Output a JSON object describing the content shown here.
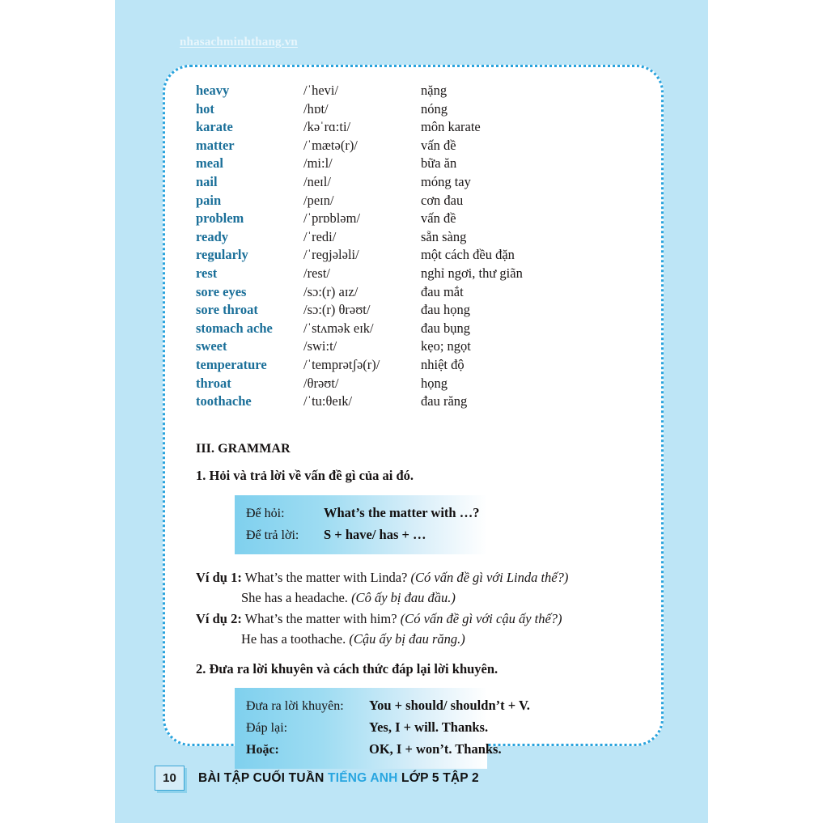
{
  "page": {
    "watermark": "nhasachminhthang.vn",
    "background_color": "#bde5f6",
    "panel_border_color": "#29a3dd",
    "accent_color": "#29a6e0",
    "headword_color": "#1a6f99"
  },
  "vocabulary": {
    "rows": [
      {
        "word": "heavy",
        "ipa": "/ˈhevi/",
        "meaning": "nặng"
      },
      {
        "word": "hot",
        "ipa": "/hɒt/",
        "meaning": "nóng"
      },
      {
        "word": "karate",
        "ipa": "/kəˈrɑ:ti/",
        "meaning": "môn karate"
      },
      {
        "word": "matter",
        "ipa": "/ˈmætə(r)/",
        "meaning": "vấn đề"
      },
      {
        "word": "meal",
        "ipa": "/mi:l/",
        "meaning": "bữa ăn"
      },
      {
        "word": "nail",
        "ipa": "/neɪl/",
        "meaning": "móng tay"
      },
      {
        "word": "pain",
        "ipa": "/peɪn/",
        "meaning": "cơn đau"
      },
      {
        "word": "problem",
        "ipa": "/ˈprɒbləm/",
        "meaning": "vấn đề"
      },
      {
        "word": "ready",
        "ipa": "/ˈredi/",
        "meaning": "sẵn sàng"
      },
      {
        "word": "regularly",
        "ipa": "/ˈreɡjələli/",
        "meaning": "một cách đều đặn"
      },
      {
        "word": "rest",
        "ipa": "/rest/",
        "meaning": "nghỉ ngơi, thư giãn"
      },
      {
        "word": "sore eyes",
        "ipa": "/sɔ:(r) aɪz/",
        "meaning": "đau mắt"
      },
      {
        "word": "sore throat",
        "ipa": "/sɔ:(r) θrəʊt/",
        "meaning": "đau họng"
      },
      {
        "word": "stomach ache",
        "ipa": "/ˈstʌmək eɪk/",
        "meaning": "đau bụng"
      },
      {
        "word": "sweet",
        "ipa": "/swi:t/",
        "meaning": "kẹo; ngọt"
      },
      {
        "word": "temperature",
        "ipa": "/ˈtemprətʃə(r)/",
        "meaning": "nhiệt độ"
      },
      {
        "word": "throat",
        "ipa": "/θrəʊt/",
        "meaning": "họng"
      },
      {
        "word": "toothache",
        "ipa": "/ˈtu:θeɪk/",
        "meaning": "đau răng"
      }
    ]
  },
  "grammar": {
    "section_heading": "III. GRAMMAR",
    "rule1": {
      "heading": "1. Hỏi và trả lời về vấn đề gì của ai đó.",
      "box": [
        {
          "label": "Để hỏi:",
          "value": "What’s the matter with …?"
        },
        {
          "label": "Để trả lời:",
          "value": "S + have/ has + …"
        }
      ],
      "examples": [
        {
          "label": "Ví dụ 1:",
          "english": " What’s the matter with Linda? ",
          "translation": "(Có vấn đề gì với Linda thế?)"
        },
        {
          "label": "",
          "english": "She has a headache. ",
          "translation": "(Cô ấy bị đau đầu.)"
        },
        {
          "label": "Ví dụ 2:",
          "english": " What’s the matter with him? ",
          "translation": "(Có vấn đề gì với cậu ấy thế?)"
        },
        {
          "label": "",
          "english": "He has a toothache. ",
          "translation": "(Cậu ấy bị đau răng.)"
        }
      ]
    },
    "rule2": {
      "heading": "2. Đưa ra lời khuyên và cách thức đáp lại lời khuyên.",
      "box": [
        {
          "label": "Đưa ra lời khuyên:",
          "value": "You + should/ shouldn’t + V.",
          "bold_label": false
        },
        {
          "label": "Đáp lại:",
          "value": "Yes, I + will. Thanks.",
          "bold_label": false
        },
        {
          "label": "Hoặc:",
          "value": "OK, I + won’t. Thanks.",
          "bold_label": true
        }
      ]
    }
  },
  "footer": {
    "page_number": "10",
    "title_part1": "BÀI TẬP CUỐI TUẦN ",
    "title_highlight": "TIẾNG ANH",
    "title_part2": " LỚP 5 TẬP 2"
  }
}
